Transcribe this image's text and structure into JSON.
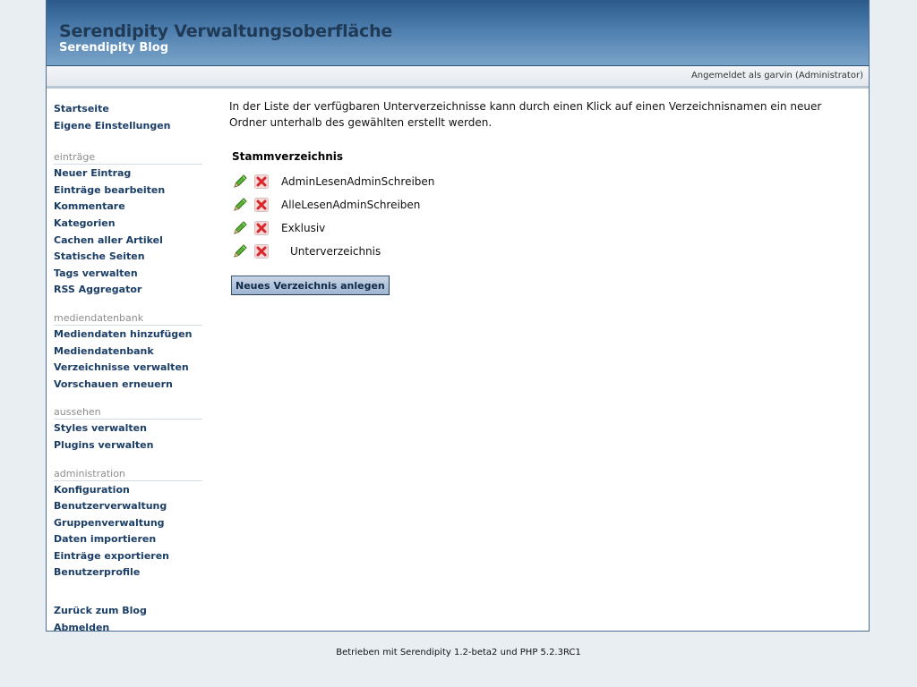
{
  "header": {
    "title": "Serendipity Verwaltungsoberfläche",
    "subtitle": "Serendipity Blog"
  },
  "userbar": {
    "text": "Angemeldet als garvin (Administrator)"
  },
  "sidebar": {
    "top_items": [
      {
        "label": "Startseite"
      },
      {
        "label": "Eigene Einstellungen"
      }
    ],
    "groups": [
      {
        "title": "einträge",
        "items": [
          {
            "label": "Neuer Eintrag"
          },
          {
            "label": "Einträge bearbeiten"
          },
          {
            "label": "Kommentare"
          },
          {
            "label": "Kategorien"
          },
          {
            "label": "Cachen aller Artikel"
          },
          {
            "label": "Statische Seiten"
          },
          {
            "label": "Tags verwalten"
          },
          {
            "label": "RSS Aggregator"
          }
        ]
      },
      {
        "title": "mediendatenbank",
        "items": [
          {
            "label": "Mediendaten hinzufügen"
          },
          {
            "label": "Mediendatenbank"
          },
          {
            "label": "Verzeichnisse verwalten"
          },
          {
            "label": "Vorschauen erneuern"
          }
        ]
      },
      {
        "title": "aussehen",
        "items": [
          {
            "label": "Styles verwalten"
          },
          {
            "label": "Plugins verwalten"
          }
        ]
      },
      {
        "title": "administration",
        "items": [
          {
            "label": "Konfiguration"
          },
          {
            "label": "Benutzerverwaltung"
          },
          {
            "label": "Gruppenverwaltung"
          },
          {
            "label": "Daten importieren"
          },
          {
            "label": "Einträge exportieren"
          },
          {
            "label": "Benutzerprofile"
          }
        ]
      }
    ],
    "bottom_items": [
      {
        "label": "Zurück zum Blog"
      },
      {
        "label": "Abmelden"
      }
    ]
  },
  "main": {
    "intro": "In der Liste der verfügbaren Unterverzeichnisse kann durch einen Klick auf einen Verzeichnisnamen ein neuer Ordner unterhalb des gewählten erstellt werden.",
    "root_title": "Stammverzeichnis",
    "directories": [
      {
        "name": "AdminLesenAdminSchreiben",
        "indent": 0
      },
      {
        "name": "AlleLesenAdminSchreiben",
        "indent": 0
      },
      {
        "name": "Exklusiv",
        "indent": 0
      },
      {
        "name": "Unterverzeichnis",
        "indent": 1
      }
    ],
    "edit_icon": "pencil-icon",
    "delete_icon": "delete-x-icon",
    "new_button": "Neues Verzeichnis anlegen"
  },
  "footer": {
    "text": "Betrieben mit Serendipity 1.2-beta2 und PHP 5.2.3RC1"
  },
  "colors": {
    "link": "#1b3e66",
    "header_top": "#2b5a8a",
    "header_bottom": "#7aa4c9",
    "page_bg": "#e9eef3",
    "edit_green": "#4a9a2a",
    "delete_red": "#d9262b"
  }
}
